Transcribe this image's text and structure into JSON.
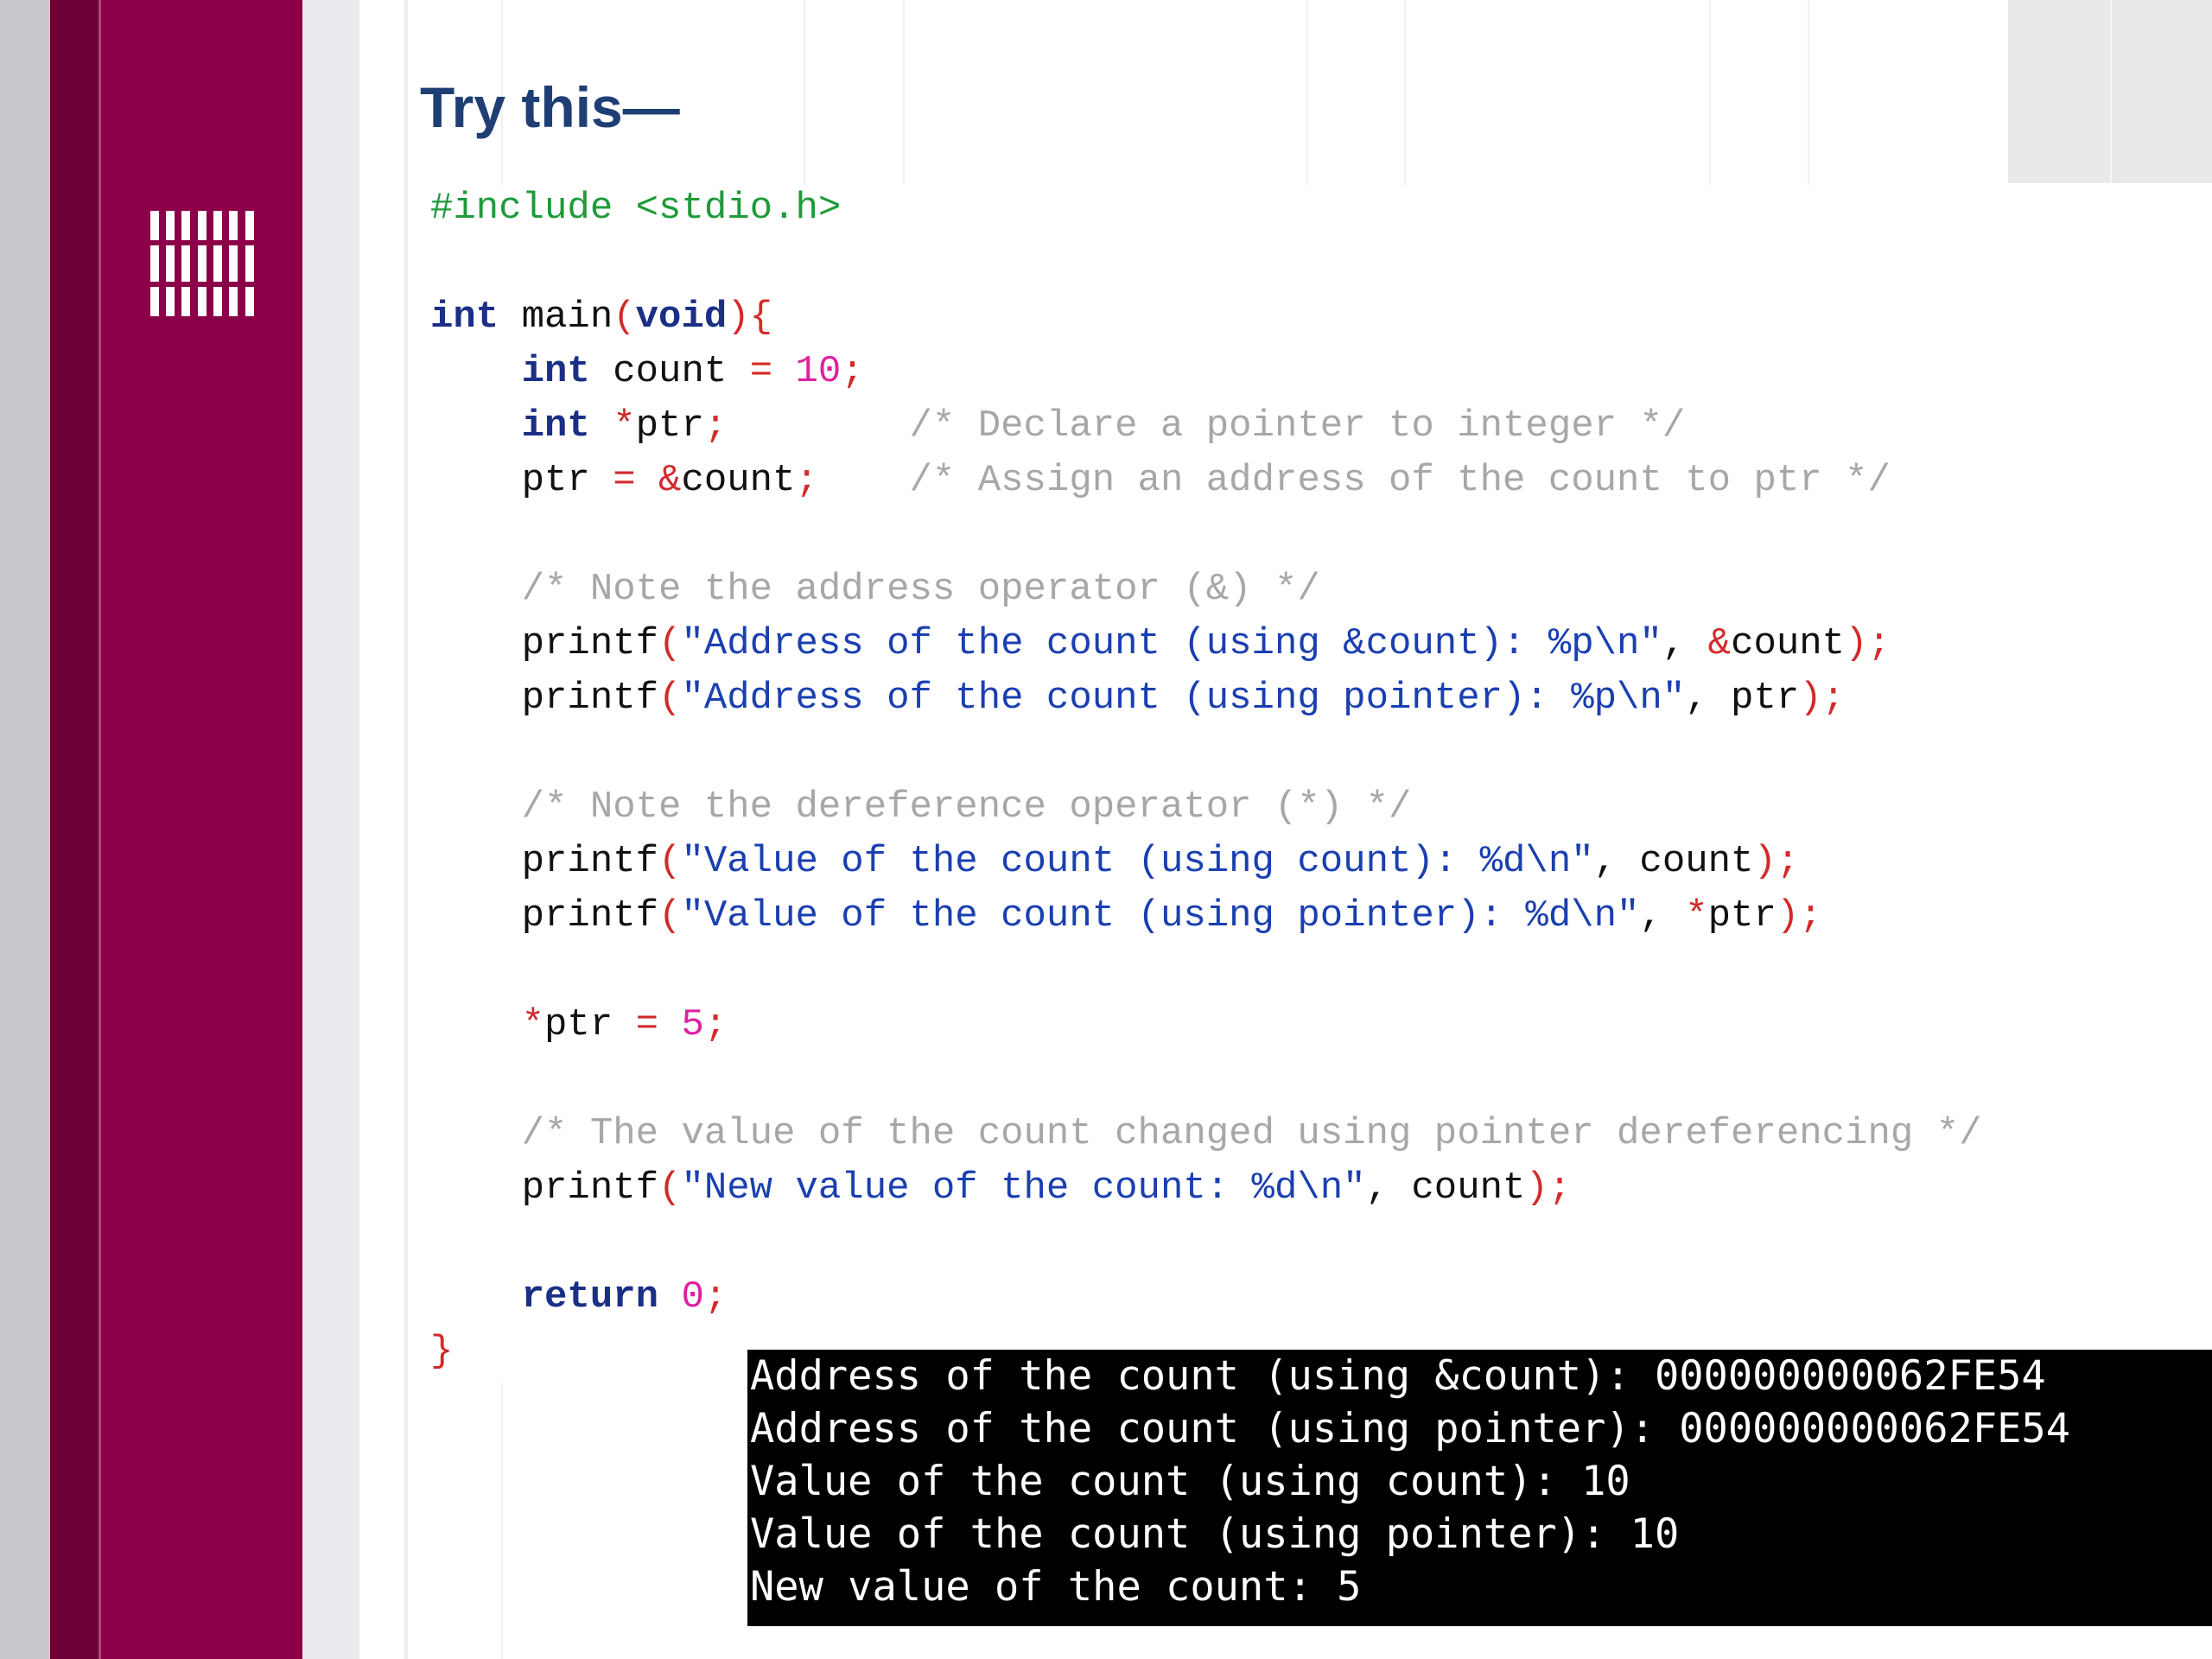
{
  "slide": {
    "title": "Try this—"
  },
  "code": {
    "lines": [
      [
        {
          "t": "#include <stdio.h>",
          "c": "pp"
        }
      ],
      [],
      [
        {
          "t": "int",
          "c": "kw"
        },
        {
          "t": " main",
          "c": "fn"
        },
        {
          "t": "(",
          "c": "op"
        },
        {
          "t": "void",
          "c": "kw"
        },
        {
          "t": "){",
          "c": "op"
        }
      ],
      [
        {
          "t": "    "
        },
        {
          "t": "int",
          "c": "kw"
        },
        {
          "t": " count "
        },
        {
          "t": "=",
          "c": "op"
        },
        {
          "t": " "
        },
        {
          "t": "10",
          "c": "num"
        },
        {
          "t": ";",
          "c": "op"
        }
      ],
      [
        {
          "t": "    "
        },
        {
          "t": "int",
          "c": "kw"
        },
        {
          "t": " "
        },
        {
          "t": "*",
          "c": "op"
        },
        {
          "t": "ptr"
        },
        {
          "t": ";",
          "c": "op"
        },
        {
          "t": "        "
        },
        {
          "t": "/* Declare a pointer to integer */",
          "c": "cmt"
        }
      ],
      [
        {
          "t": "    ptr "
        },
        {
          "t": "=",
          "c": "op"
        },
        {
          "t": " "
        },
        {
          "t": "&",
          "c": "op"
        },
        {
          "t": "count"
        },
        {
          "t": ";",
          "c": "op"
        },
        {
          "t": "    "
        },
        {
          "t": "/* Assign an address of the count to ptr */",
          "c": "cmt"
        }
      ],
      [],
      [
        {
          "t": "    "
        },
        {
          "t": "/* Note the address operator (&) */",
          "c": "cmt"
        }
      ],
      [
        {
          "t": "    printf"
        },
        {
          "t": "(",
          "c": "op"
        },
        {
          "t": "\"Address of the count (using &count): %p\\n\"",
          "c": "str"
        },
        {
          "t": ", "
        },
        {
          "t": "&",
          "c": "op"
        },
        {
          "t": "count"
        },
        {
          "t": ");",
          "c": "op"
        }
      ],
      [
        {
          "t": "    printf"
        },
        {
          "t": "(",
          "c": "op"
        },
        {
          "t": "\"Address of the count (using pointer): %p\\n\"",
          "c": "str"
        },
        {
          "t": ", ptr"
        },
        {
          "t": ");",
          "c": "op"
        }
      ],
      [],
      [
        {
          "t": "    "
        },
        {
          "t": "/* Note the dereference operator (*) */",
          "c": "cmt"
        }
      ],
      [
        {
          "t": "    printf"
        },
        {
          "t": "(",
          "c": "op"
        },
        {
          "t": "\"Value of the count (using count): %d\\n\"",
          "c": "str"
        },
        {
          "t": ", count"
        },
        {
          "t": ");",
          "c": "op"
        }
      ],
      [
        {
          "t": "    printf"
        },
        {
          "t": "(",
          "c": "op"
        },
        {
          "t": "\"Value of the count (using pointer): %d\\n\"",
          "c": "str"
        },
        {
          "t": ", "
        },
        {
          "t": "*",
          "c": "op"
        },
        {
          "t": "ptr"
        },
        {
          "t": ");",
          "c": "op"
        }
      ],
      [],
      [
        {
          "t": "    "
        },
        {
          "t": "*",
          "c": "op"
        },
        {
          "t": "ptr "
        },
        {
          "t": "=",
          "c": "op"
        },
        {
          "t": " "
        },
        {
          "t": "5",
          "c": "num"
        },
        {
          "t": ";",
          "c": "op"
        }
      ],
      [],
      [
        {
          "t": "    "
        },
        {
          "t": "/* The value of the count changed using pointer dereferencing */",
          "c": "cmt"
        }
      ],
      [
        {
          "t": "    printf"
        },
        {
          "t": "(",
          "c": "op"
        },
        {
          "t": "\"New value of the count: %d\\n\"",
          "c": "str"
        },
        {
          "t": ", count"
        },
        {
          "t": ");",
          "c": "op"
        }
      ],
      [],
      [
        {
          "t": "    "
        },
        {
          "t": "return",
          "c": "kw"
        },
        {
          "t": " "
        },
        {
          "t": "0",
          "c": "num"
        },
        {
          "t": ";",
          "c": "op"
        }
      ],
      [
        {
          "t": "}",
          "c": "op"
        }
      ]
    ]
  },
  "console": {
    "lines": [
      "Address of the count (using &count): 000000000062FE54",
      "Address of the count (using pointer): 000000000062FE54",
      "Value of the count (using count): 10",
      "Value of the count (using pointer): 10",
      "New value of the count: 5"
    ]
  }
}
